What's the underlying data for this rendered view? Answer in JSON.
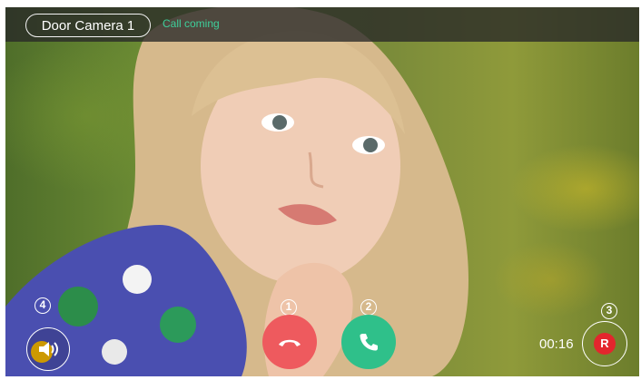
{
  "topbar": {
    "camera_label": "Door Camera 1",
    "status_text": "Call coming"
  },
  "markers": {
    "hangup": "1",
    "answer": "2",
    "record": "3",
    "speaker": "4"
  },
  "record": {
    "label": "R",
    "timer": "00:16"
  },
  "colors": {
    "hangup": "#ee5a5e",
    "answer": "#2fc08a",
    "status": "#3ecf9b",
    "record": "#e3262d"
  },
  "icons": {
    "hangup": "phone-hangup-icon",
    "answer": "phone-icon",
    "speaker": "speaker-icon"
  }
}
